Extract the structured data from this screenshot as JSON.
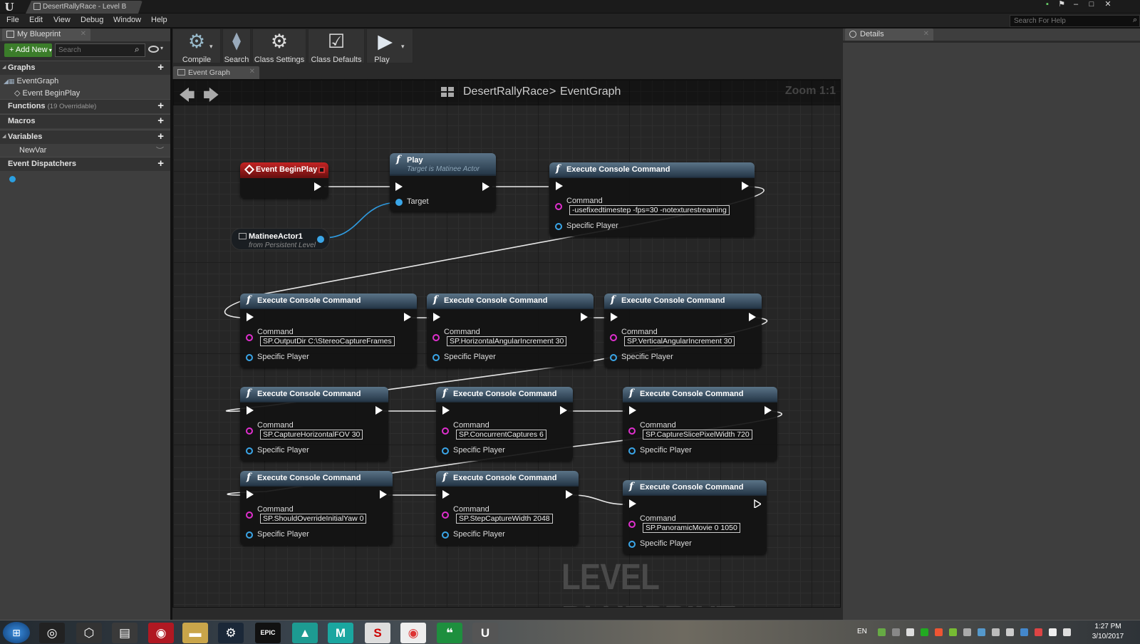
{
  "window": {
    "tab_title": "DesertRallyRace - Level B",
    "help_search_placeholder": "Search For Help"
  },
  "menu": [
    "File",
    "Edit",
    "View",
    "Debug",
    "Window",
    "Help"
  ],
  "left_panel": {
    "tab": "My Blueprint",
    "add_new": "Add New",
    "search_placeholder": "Search",
    "sections": {
      "graphs": "Graphs",
      "functions": "Functions",
      "functions_sub": "(19 Overridable)",
      "macros": "Macros",
      "variables": "Variables",
      "dispatchers": "Event Dispatchers"
    },
    "tree": {
      "eventgraph": "EventGraph",
      "beginplay": "Event BeginPlay",
      "newvar": "NewVar"
    }
  },
  "toolbar": {
    "compile": "Compile",
    "search": "Search",
    "class_settings": "Class Settings",
    "class_defaults": "Class Defaults",
    "play": "Play"
  },
  "graph": {
    "tab": "Event Graph",
    "breadcrumb_1": "DesertRallyRace",
    "breadcrumb_sep": ">",
    "breadcrumb_2": "EventGraph",
    "zoom": "Zoom 1:1",
    "watermark": "LEVEL BLUEPRINT",
    "event_beginplay": "Event BeginPlay",
    "play_title": "Play",
    "play_sub": "Target is Matinee Actor",
    "play_target": "Target",
    "matinee_title": "MatineeActor1",
    "matinee_sub": "from Persistent Level",
    "exec_title": "Execute Console Command",
    "pin_command": "Command",
    "pin_player": "Specific Player",
    "commands": [
      "-usefixedtimestep -fps=30 -notexturestreaming",
      "SP.OutputDir C:\\StereoCaptureFrames",
      "SP.HorizontalAngularIncrement 30",
      "SP.VerticalAngularIncrement 30",
      "SP.CaptureHorizontalFOV 30",
      "SP.ConcurrentCaptures 6",
      "SP.CaptureSlicePixelWidth 720",
      "SP.ShouldOverrideInitialYaw 0",
      "SP.StepCaptureWidth 2048",
      "SP.PanoramicMovie 0 1050"
    ]
  },
  "right_panel": {
    "tab": "Details"
  },
  "taskbar": {
    "lang": "EN",
    "time": "1:27 PM",
    "date": "3/10/2017"
  }
}
